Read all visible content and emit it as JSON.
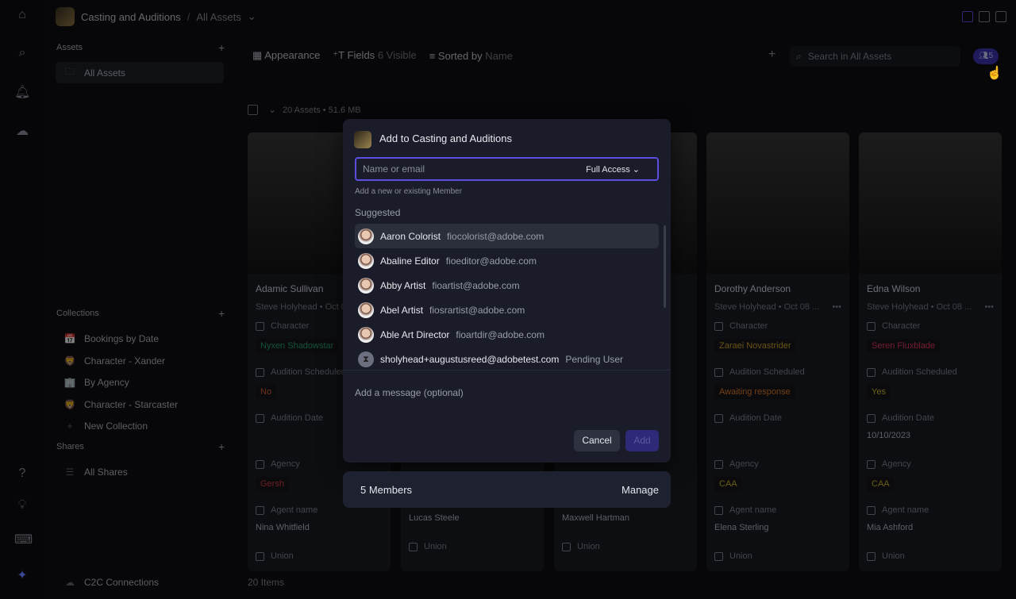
{
  "breadcrumb": {
    "project": "Casting and Auditions",
    "current": "All Assets"
  },
  "sidebar": {
    "assets_header": "Assets",
    "all_assets": "All Assets",
    "collections_header": "Collections",
    "collections": [
      {
        "label": "Bookings by Date",
        "icon": "📅"
      },
      {
        "label": "Character - Xander",
        "icon": "🦁"
      },
      {
        "label": "By Agency",
        "icon": "🏢"
      },
      {
        "label": "Character - Starcaster",
        "icon": "🦁"
      },
      {
        "label": "New Collection",
        "icon": "+"
      }
    ],
    "shares_header": "Shares",
    "all_shares": "All Shares",
    "c2c": "C2C Connections"
  },
  "toolbar": {
    "appearance": "Appearance",
    "fields": "Fields",
    "fields_count": "6 Visible",
    "sorted": "Sorted by",
    "sorted_value": "Name",
    "search_placeholder": "Search in All Assets",
    "members_count": "5"
  },
  "summary": "20 Assets • 51.6 MB",
  "footer_count": "20 Items",
  "field_labels": {
    "character": "Character",
    "audition": "Audition Scheduled",
    "date": "Audition Date",
    "agency": "Agency",
    "agent": "Agent name",
    "union": "Union"
  },
  "cards": [
    {
      "name": "Adamic Sullivan",
      "meta": "Steve Holyhead • Oct 0",
      "character": "Nyxen Shadowstar",
      "char_color": "#1f8a60",
      "audition": "No",
      "aud_color": "#c0502a",
      "date": "",
      "agency": "Gersh",
      "agency_color": "#b0303a",
      "agent": "Nina Whitfield"
    },
    {
      "name": "",
      "meta": "",
      "character": "",
      "audition": "",
      "date": "",
      "agency": "",
      "agent": "Lucas Steele"
    },
    {
      "name": "",
      "meta": "",
      "character": "",
      "audition": "",
      "date": "",
      "agency": "",
      "agent": "Maxwell Hartman"
    },
    {
      "name": "Dorothy Anderson",
      "meta": "Steve Holyhead • Oct 08 ...",
      "character": "Zaraei Novastrider",
      "char_color": "#b08a20",
      "audition": "Awaiting response",
      "aud_color": "#c06a20",
      "date": "",
      "agency": "CAA",
      "agency_color": "#b09a20",
      "agent": "Elena Sterling"
    },
    {
      "name": "Edna Wilson",
      "meta": "Steve Holyhead • Oct 08 ...",
      "character": "Seren Fluxblade",
      "char_color": "#c03050",
      "audition": "Yes",
      "aud_color": "#b0a020",
      "date": "10/10/2023",
      "agency": "CAA",
      "agency_color": "#b09a20",
      "agent": "Mia Ashford"
    }
  ],
  "modal": {
    "title": "Add to Casting and Auditions",
    "input_placeholder": "Name or email",
    "input_value": "",
    "access": "Full Access",
    "hint": "Add a new or existing Member",
    "suggested": "Suggested",
    "users": [
      {
        "name": "Aaron Colorist",
        "email": "fiocolorist@adobe.com"
      },
      {
        "name": "Abaline Editor",
        "email": "fioeditor@adobe.com"
      },
      {
        "name": "Abby Artist",
        "email": "fioartist@adobe.com"
      },
      {
        "name": "Abel Artist",
        "email": "fiosrartist@adobe.com"
      },
      {
        "name": "Able Art Director",
        "email": "fioartdir@adobe.com"
      },
      {
        "name": "sholyhead+augustusreed@adobetest.com",
        "email": "Pending User"
      }
    ],
    "message_placeholder": "Add a message (optional)",
    "cancel": "Cancel",
    "add": "Add"
  },
  "members_bar": {
    "label": "5 Members",
    "manage": "Manage"
  }
}
